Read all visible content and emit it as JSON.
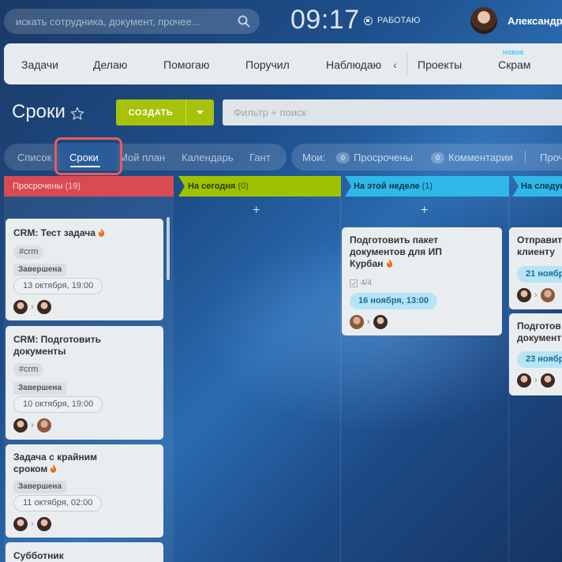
{
  "search": {
    "placeholder": "искать сотрудника, документ, прочее..."
  },
  "header": {
    "time": "09:17",
    "work_status": "РАБОТАЮ",
    "user_name": "Александр"
  },
  "nav": {
    "items": [
      "Задачи",
      "Делаю",
      "Помогаю",
      "Поручил",
      "Наблюдаю",
      "Проекты",
      "Скрам"
    ],
    "scroll_arrow": "‹",
    "new_badge": "НОВОЕ"
  },
  "title": {
    "text": "Сроки"
  },
  "create_button": {
    "label": "СОЗДАТЬ"
  },
  "filter": {
    "placeholder": "Фильтр + поиск"
  },
  "views": {
    "items": [
      "Список",
      "Сроки",
      "Мой план",
      "Календарь",
      "Гант"
    ],
    "active": "Сроки"
  },
  "filters": {
    "mine_label": "Мои:",
    "overdue": {
      "count": "0",
      "label": "Просрочены"
    },
    "comments": {
      "count": "0",
      "label": "Комментарии"
    },
    "extra": "Проч"
  },
  "columns": [
    {
      "title": "Просрочены",
      "count": "(19)",
      "color": "#d94a52"
    },
    {
      "title": "На сегодня",
      "count": "(0)",
      "color": "#9cc200"
    },
    {
      "title": "На этой неделе",
      "count": "(1)",
      "color": "#2fb8e8"
    },
    {
      "title": "На следую",
      "count": "",
      "color": "#2fb8e8"
    }
  ],
  "add_symbol": "+",
  "cards": {
    "c1": {
      "title": "CRM: Тест задача",
      "tag": "#crm",
      "status": "Завершена",
      "date": "13 октября, 19:00"
    },
    "c2": {
      "title_l1": "CRM: Подготовить",
      "title_l2": "документы",
      "tag": "#crm",
      "status": "Завершена",
      "date": "10 октября, 19:00"
    },
    "c3": {
      "title_l1": "Задача с крайним",
      "title_l2": "сроком",
      "status": "Завершена",
      "date": "11 октября, 02:00"
    },
    "c4": {
      "title": "Субботник"
    },
    "w1": {
      "title_l1": "Подготовить пакет",
      "title_l2": "документов для ИП",
      "title_l3": "Курбан",
      "checklist": "4/4",
      "date": "16 ноября, 13:00"
    },
    "n1": {
      "title_l1": "Отправить",
      "title_l2": "клиенту",
      "date": "21 ноябр"
    },
    "n2": {
      "title_l1": "Подготов",
      "title_l2": "документ",
      "date": "23 ноябр"
    }
  },
  "colors": {
    "create_button": "#a8c20a",
    "overdue": "#d94a52",
    "today": "#9cc200",
    "week": "#2fb8e8",
    "highlight": "#e85a60"
  }
}
